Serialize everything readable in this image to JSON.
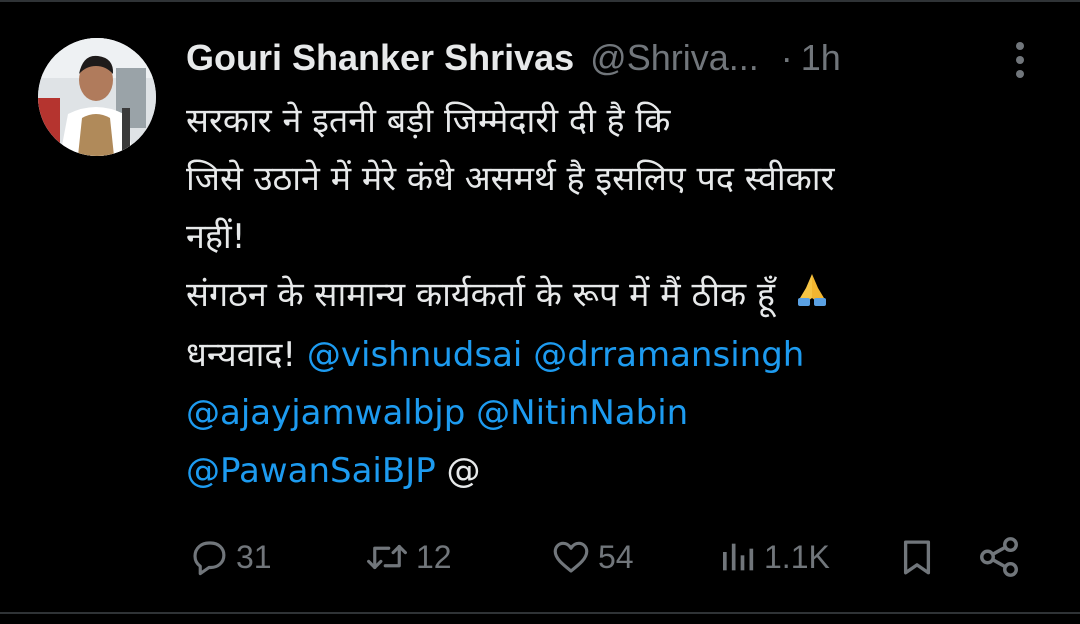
{
  "author": {
    "name": "Gouri Shanker Shrivas",
    "handle": "@Shriva...",
    "separator": "·",
    "time": "1h"
  },
  "tweet": {
    "lines": [
      "सरकार ने इतनी बड़ी जिम्मेदारी दी है कि",
      "जिसे उठाने में मेरे कंधे असमर्थ है इसलिए पद स्वीकार",
      "नहीं!",
      "संगठन के सामान्य कार्यकर्ता के रूप में मैं ठीक हूँ"
    ],
    "thanks": "धन्यवाद!",
    "mentions": [
      "@vishnudsai",
      "@drramansingh",
      "@ajayjamwalbjp",
      "@NitinNabin",
      "@PawanSaiBJP"
    ],
    "trailing": "@",
    "emoji": "folded-hands"
  },
  "actions": {
    "replies": "31",
    "reposts": "12",
    "likes": "54",
    "views": "1.1K"
  },
  "colors": {
    "background": "#000000",
    "text": "#e7e9ea",
    "muted": "#71767b",
    "link": "#1d9bf0",
    "divider": "#2f3336"
  },
  "icons": [
    "more-vertical-icon",
    "reply-icon",
    "repost-icon",
    "like-icon",
    "views-icon",
    "bookmark-icon",
    "share-icon"
  ]
}
